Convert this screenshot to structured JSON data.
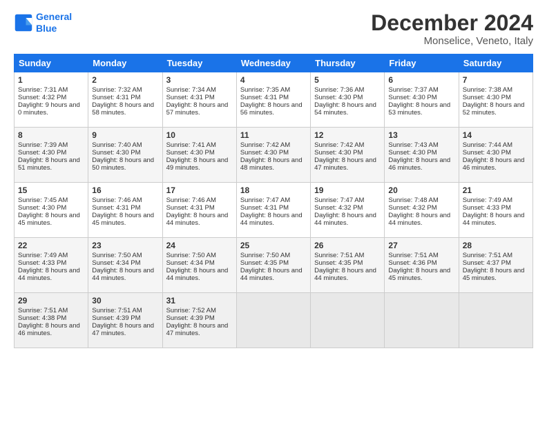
{
  "header": {
    "logo_line1": "General",
    "logo_line2": "Blue",
    "month": "December 2024",
    "location": "Monselice, Veneto, Italy"
  },
  "days_of_week": [
    "Sunday",
    "Monday",
    "Tuesday",
    "Wednesday",
    "Thursday",
    "Friday",
    "Saturday"
  ],
  "weeks": [
    [
      {
        "day": "1",
        "sunrise": "Sunrise: 7:31 AM",
        "sunset": "Sunset: 4:32 PM",
        "daylight": "Daylight: 9 hours and 0 minutes."
      },
      {
        "day": "2",
        "sunrise": "Sunrise: 7:32 AM",
        "sunset": "Sunset: 4:31 PM",
        "daylight": "Daylight: 8 hours and 58 minutes."
      },
      {
        "day": "3",
        "sunrise": "Sunrise: 7:34 AM",
        "sunset": "Sunset: 4:31 PM",
        "daylight": "Daylight: 8 hours and 57 minutes."
      },
      {
        "day": "4",
        "sunrise": "Sunrise: 7:35 AM",
        "sunset": "Sunset: 4:31 PM",
        "daylight": "Daylight: 8 hours and 56 minutes."
      },
      {
        "day": "5",
        "sunrise": "Sunrise: 7:36 AM",
        "sunset": "Sunset: 4:30 PM",
        "daylight": "Daylight: 8 hours and 54 minutes."
      },
      {
        "day": "6",
        "sunrise": "Sunrise: 7:37 AM",
        "sunset": "Sunset: 4:30 PM",
        "daylight": "Daylight: 8 hours and 53 minutes."
      },
      {
        "day": "7",
        "sunrise": "Sunrise: 7:38 AM",
        "sunset": "Sunset: 4:30 PM",
        "daylight": "Daylight: 8 hours and 52 minutes."
      }
    ],
    [
      {
        "day": "8",
        "sunrise": "Sunrise: 7:39 AM",
        "sunset": "Sunset: 4:30 PM",
        "daylight": "Daylight: 8 hours and 51 minutes."
      },
      {
        "day": "9",
        "sunrise": "Sunrise: 7:40 AM",
        "sunset": "Sunset: 4:30 PM",
        "daylight": "Daylight: 8 hours and 50 minutes."
      },
      {
        "day": "10",
        "sunrise": "Sunrise: 7:41 AM",
        "sunset": "Sunset: 4:30 PM",
        "daylight": "Daylight: 8 hours and 49 minutes."
      },
      {
        "day": "11",
        "sunrise": "Sunrise: 7:42 AM",
        "sunset": "Sunset: 4:30 PM",
        "daylight": "Daylight: 8 hours and 48 minutes."
      },
      {
        "day": "12",
        "sunrise": "Sunrise: 7:42 AM",
        "sunset": "Sunset: 4:30 PM",
        "daylight": "Daylight: 8 hours and 47 minutes."
      },
      {
        "day": "13",
        "sunrise": "Sunrise: 7:43 AM",
        "sunset": "Sunset: 4:30 PM",
        "daylight": "Daylight: 8 hours and 46 minutes."
      },
      {
        "day": "14",
        "sunrise": "Sunrise: 7:44 AM",
        "sunset": "Sunset: 4:30 PM",
        "daylight": "Daylight: 8 hours and 46 minutes."
      }
    ],
    [
      {
        "day": "15",
        "sunrise": "Sunrise: 7:45 AM",
        "sunset": "Sunset: 4:30 PM",
        "daylight": "Daylight: 8 hours and 45 minutes."
      },
      {
        "day": "16",
        "sunrise": "Sunrise: 7:46 AM",
        "sunset": "Sunset: 4:31 PM",
        "daylight": "Daylight: 8 hours and 45 minutes."
      },
      {
        "day": "17",
        "sunrise": "Sunrise: 7:46 AM",
        "sunset": "Sunset: 4:31 PM",
        "daylight": "Daylight: 8 hours and 44 minutes."
      },
      {
        "day": "18",
        "sunrise": "Sunrise: 7:47 AM",
        "sunset": "Sunset: 4:31 PM",
        "daylight": "Daylight: 8 hours and 44 minutes."
      },
      {
        "day": "19",
        "sunrise": "Sunrise: 7:47 AM",
        "sunset": "Sunset: 4:32 PM",
        "daylight": "Daylight: 8 hours and 44 minutes."
      },
      {
        "day": "20",
        "sunrise": "Sunrise: 7:48 AM",
        "sunset": "Sunset: 4:32 PM",
        "daylight": "Daylight: 8 hours and 44 minutes."
      },
      {
        "day": "21",
        "sunrise": "Sunrise: 7:49 AM",
        "sunset": "Sunset: 4:33 PM",
        "daylight": "Daylight: 8 hours and 44 minutes."
      }
    ],
    [
      {
        "day": "22",
        "sunrise": "Sunrise: 7:49 AM",
        "sunset": "Sunset: 4:33 PM",
        "daylight": "Daylight: 8 hours and 44 minutes."
      },
      {
        "day": "23",
        "sunrise": "Sunrise: 7:50 AM",
        "sunset": "Sunset: 4:34 PM",
        "daylight": "Daylight: 8 hours and 44 minutes."
      },
      {
        "day": "24",
        "sunrise": "Sunrise: 7:50 AM",
        "sunset": "Sunset: 4:34 PM",
        "daylight": "Daylight: 8 hours and 44 minutes."
      },
      {
        "day": "25",
        "sunrise": "Sunrise: 7:50 AM",
        "sunset": "Sunset: 4:35 PM",
        "daylight": "Daylight: 8 hours and 44 minutes."
      },
      {
        "day": "26",
        "sunrise": "Sunrise: 7:51 AM",
        "sunset": "Sunset: 4:35 PM",
        "daylight": "Daylight: 8 hours and 44 minutes."
      },
      {
        "day": "27",
        "sunrise": "Sunrise: 7:51 AM",
        "sunset": "Sunset: 4:36 PM",
        "daylight": "Daylight: 8 hours and 45 minutes."
      },
      {
        "day": "28",
        "sunrise": "Sunrise: 7:51 AM",
        "sunset": "Sunset: 4:37 PM",
        "daylight": "Daylight: 8 hours and 45 minutes."
      }
    ],
    [
      {
        "day": "29",
        "sunrise": "Sunrise: 7:51 AM",
        "sunset": "Sunset: 4:38 PM",
        "daylight": "Daylight: 8 hours and 46 minutes."
      },
      {
        "day": "30",
        "sunrise": "Sunrise: 7:51 AM",
        "sunset": "Sunset: 4:39 PM",
        "daylight": "Daylight: 8 hours and 47 minutes."
      },
      {
        "day": "31",
        "sunrise": "Sunrise: 7:52 AM",
        "sunset": "Sunset: 4:39 PM",
        "daylight": "Daylight: 8 hours and 47 minutes."
      },
      null,
      null,
      null,
      null
    ]
  ]
}
